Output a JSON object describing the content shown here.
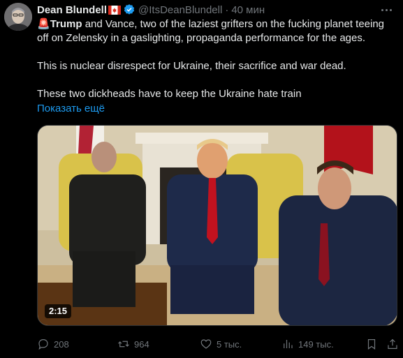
{
  "tweet": {
    "author_name": "Dean Blundell",
    "handle": "@ItsDeanBlundell",
    "separator": "·",
    "time": "40 мин",
    "emoji": "🚨",
    "bold_lead": "Trump",
    "line1_rest": " and Vance, two of the laziest grifters on the fucking planet teeing off on Zelensky in a gaslighting, propaganda performance for the ages.",
    "line2": "This is nuclear disrespect for Ukraine, their sacrifice and war dead.",
    "line3": "These two dickheads have to keep the Ukraine hate train",
    "show_more": "Показать ещё",
    "video_duration": "2:15"
  },
  "actions": {
    "replies": "208",
    "retweets": "964",
    "likes": "5 тыс.",
    "views": "149 тыс."
  },
  "icons": {
    "verified": "verified-badge-icon",
    "flag": "canada-flag-icon",
    "more": "more-options-icon",
    "reply": "reply-icon",
    "retweet": "retweet-icon",
    "like": "heart-icon",
    "views": "views-chart-icon",
    "bookmark": "bookmark-icon",
    "share": "share-icon"
  },
  "colors": {
    "background": "#000000",
    "text": "#e7e9ea",
    "muted": "#71767b",
    "link": "#1d9bf0",
    "verified": "#1d9bf0"
  }
}
